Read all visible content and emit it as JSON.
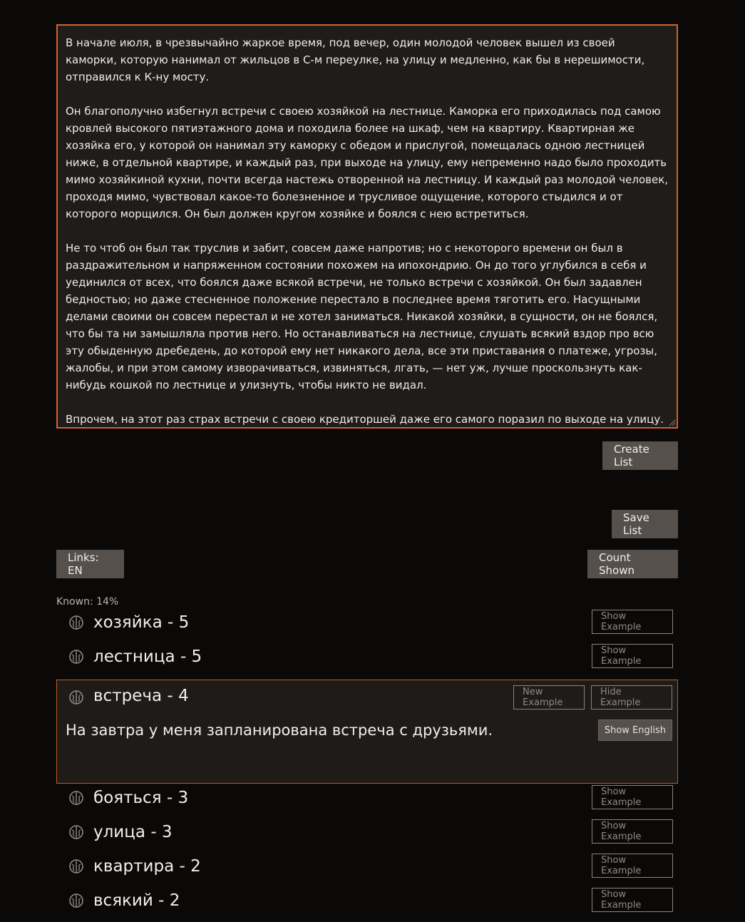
{
  "source_text": {
    "paragraphs": [
      "В начале июля, в чрезвычайно жаркое время, под вечер, один молодой человек вышел из своей каморки, которую нанимал от жильцов в С-м переулке, на улицу и медленно, как бы в нерешимости, отправился к К-ну мосту.",
      "Он благополучно избегнул встречи с своею хозяйкой на лестнице. Каморка его приходилась под самою кровлей высокого пятиэтажного дома и походила более на шкаф, чем на квартиру. Квартирная же хозяйка его, у которой он нанимал эту каморку с обедом и прислугой, помещалась одною лестницей ниже, в отдельной квартире, и каждый раз, при выходе на улицу, ему непременно надо было проходить мимо хозяйкиной кухни, почти всегда настежь отворенной на лестницу. И каждый раз молодой человек, проходя мимо, чувствовал какое-то болезненное и трусливое ощущение, которого стыдился и от которого морщился. Он был должен кругом хозяйке и боялся с нею встретиться.",
      "Не то чтоб он был так труслив и забит, совсем даже напротив; но с некоторого времени он был в раздражительном и напряженном состоянии похожем на ипохондрию. Он до того углубился в себя и уединился от всех, что боялся даже всякой встречи, не только встречи с хозяйкой. Он был задавлен бедностью; но даже стесненное положение перестало в последнее время тяготить его. Насущными делами своими он совсем перестал и не хотел заниматься. Никакой хозяйки, в сущности, он не боялся, что бы та ни замышляла против него. Но останавливаться на лестнице, слушать всякий вздор про всю эту обыденную дребедень, до которой ему нет никакого дела, все эти приставания о платеже, угрозы, жалобы, и при этом самому изворачиваться, извиняться, лгать, — нет уж, лучше проскользнуть как-нибудь кошкой по лестнице и улизнуть, чтобы никто не видал.",
      "Впрочем, на этот раз страх встречи с своею кредиторшей даже его самого поразил по выходе на улицу."
    ]
  },
  "buttons": {
    "create_list": "Create List",
    "save_list": "Save List",
    "links": "Links: EN",
    "count_shown": "Count Shown",
    "show_example": "Show Example",
    "hide_example": "Hide Example",
    "new_example": "New Example",
    "show_english": "Show English"
  },
  "known": "Known: 14%",
  "words": [
    {
      "label": "хозяйка  - 5"
    },
    {
      "label": "лестница  - 5"
    },
    {
      "label": "встреча  - 4",
      "example": "На завтра у меня запланирована встреча с друзьями."
    },
    {
      "label": "бояться  - 3"
    },
    {
      "label": "улица  - 3"
    },
    {
      "label": "квартира  - 2"
    },
    {
      "label": "всякий  - 2"
    }
  ],
  "colors": {
    "background": "#0b0908",
    "panel": "#201c1a",
    "accent_border": "#d2622f",
    "button": "#55504c"
  },
  "icons": {
    "word_status": "brain-icon"
  }
}
